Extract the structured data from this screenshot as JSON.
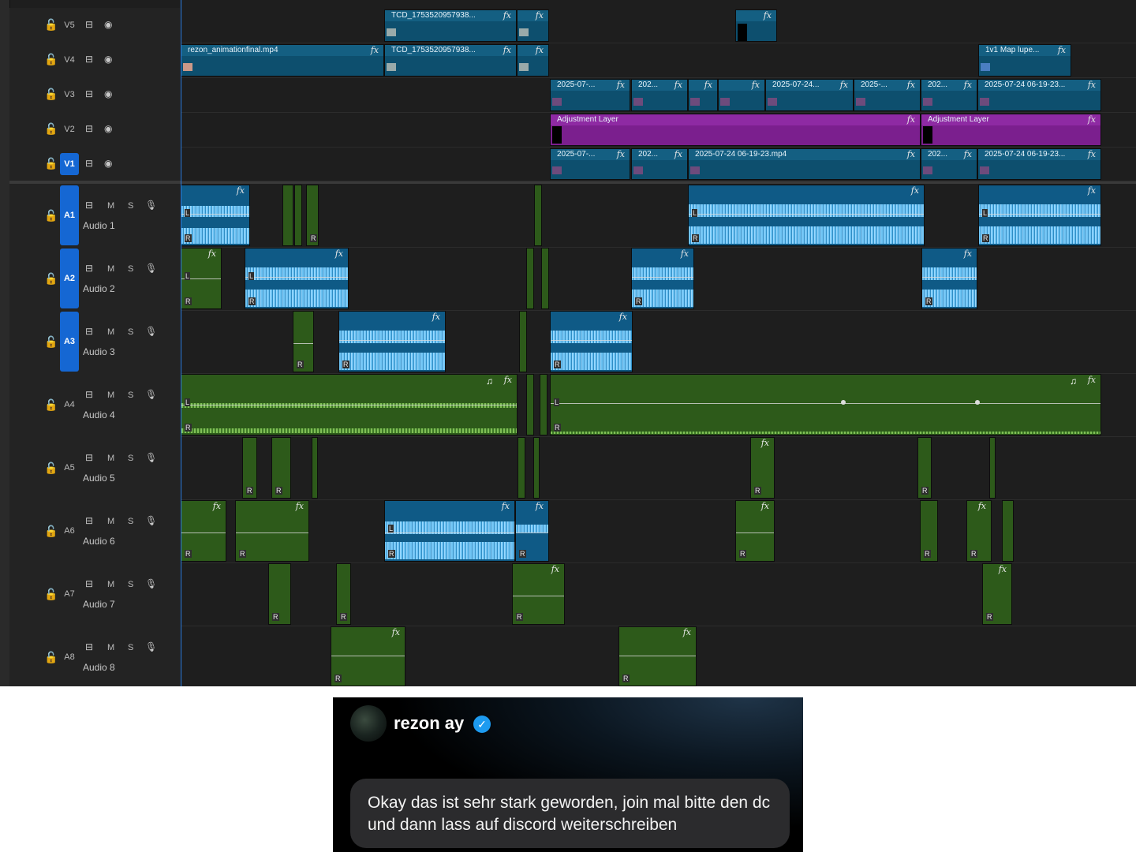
{
  "timeline": {
    "video_tracks": [
      {
        "label": "V5"
      },
      {
        "label": "V4"
      },
      {
        "label": "V3"
      },
      {
        "label": "V2"
      },
      {
        "label": "V1",
        "active": true
      }
    ],
    "audio_tracks": [
      {
        "label": "A1",
        "name": "Audio 1",
        "active": true
      },
      {
        "label": "A2",
        "name": "Audio 2",
        "active": true
      },
      {
        "label": "A3",
        "name": "Audio 3",
        "active": true
      },
      {
        "label": "A4",
        "name": "Audio 4"
      },
      {
        "label": "A5",
        "name": "Audio 5"
      },
      {
        "label": "A6",
        "name": "Audio 6"
      },
      {
        "label": "A7",
        "name": "Audio 7"
      },
      {
        "label": "A8",
        "name": "Audio 8"
      }
    ],
    "mute_label": "M",
    "solo_label": "S",
    "channel_left": "L",
    "channel_right": "R",
    "fx_label": "fx",
    "clips": {
      "v5_a": "TCD_1753520957938...",
      "v4_a": "rezon_animationfinal.mp4",
      "v4_b": "TCD_1753520957938...",
      "v4_c": "1v1 Map lupe...",
      "v3_a": "2025-07-...",
      "v3_b": "202...",
      "v3_c": "2025-07-24...",
      "v3_d": "2025-...",
      "v3_e": "202...",
      "v3_f": "2025-07-24 06-19-23...",
      "v2_a": "Adjustment Layer",
      "v2_b": "Adjustment Layer",
      "v1_a": "2025-07-...",
      "v1_b": "202...",
      "v1_c": "2025-07-24 06-19-23.mp4",
      "v1_d": "202...",
      "v1_e": "2025-07-24 06-19-23..."
    },
    "colors": {
      "video_clip": "#0d4f6e",
      "adjustment_layer": "#7b1f8e",
      "audio_blue": "#0f5a86",
      "audio_green": "#2d5a1a",
      "track_active": "#1567d3"
    }
  },
  "notification": {
    "username": "rezon ay",
    "verified_icon": "verified-badge-icon",
    "message": "Okay das ist sehr stark geworden, join mal bitte den dc und dann lass auf discord weiterschreiben"
  }
}
